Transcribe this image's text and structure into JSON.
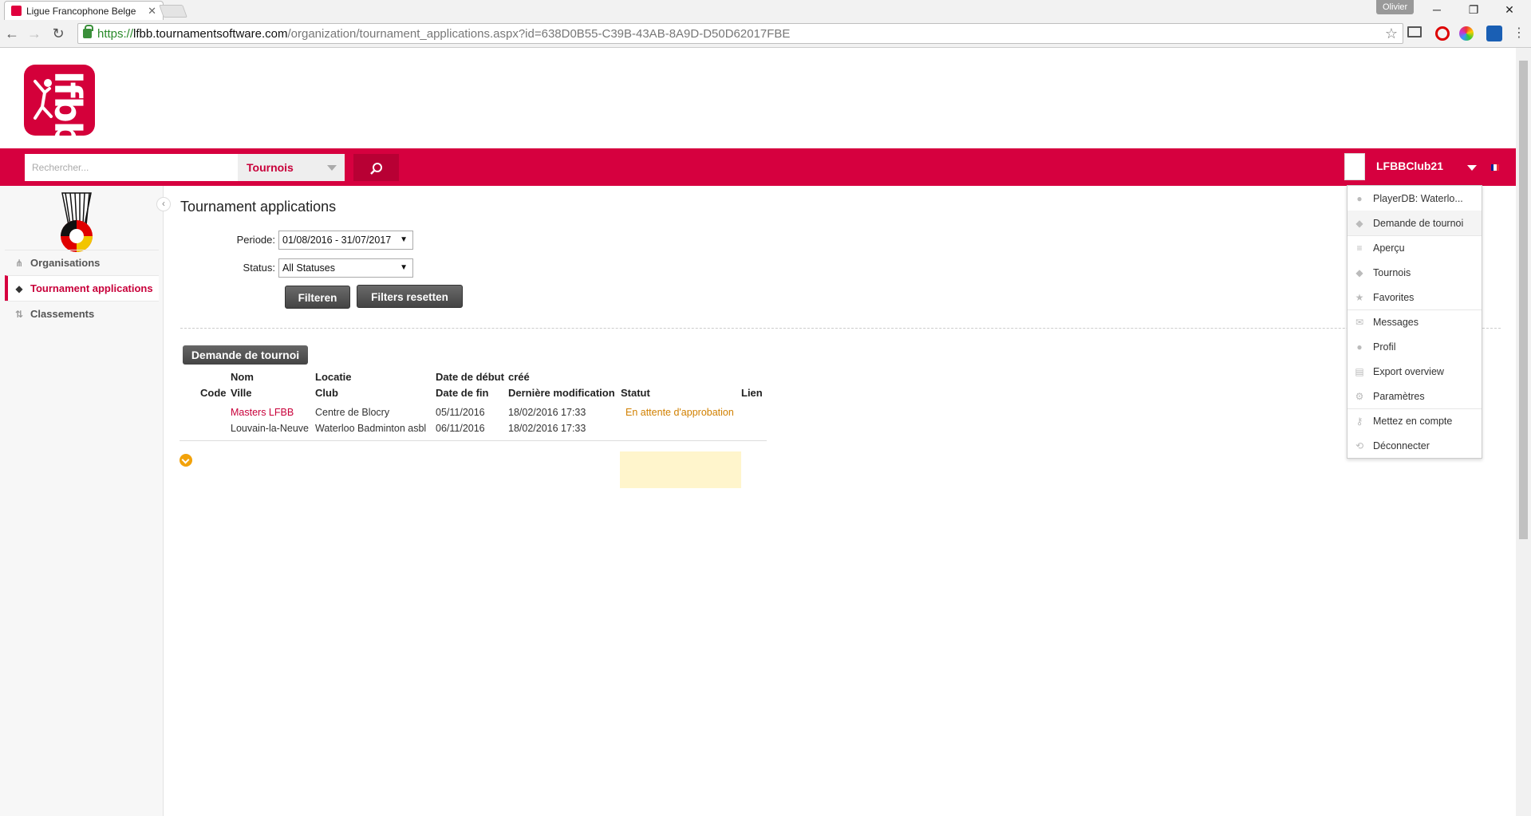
{
  "browser": {
    "tab_title": "Ligue Francophone Belge",
    "profile": "Olivier",
    "url_scheme": "https://",
    "url_host": "lfbb.tournamentsoftware.com",
    "url_path": "/organization/tournament_applications.aspx?id=638D0B55-C39B-43AB-8A9D-D50D62017FBE"
  },
  "site": {
    "logo_text": "lfbb",
    "search_placeholder": "Rechercher...",
    "search_type": "Tournois",
    "user_name": "LFBBClub21"
  },
  "user_menu": [
    {
      "label": "PlayerDB: Waterlo...",
      "icon": "user-icon"
    },
    {
      "label": "Demande de tournoi",
      "icon": "shuttle-icon"
    },
    {
      "label": "Aperçu",
      "icon": "list-icon"
    },
    {
      "label": "Tournois",
      "icon": "shuttle-icon"
    },
    {
      "label": "Favorites",
      "icon": "star-icon"
    },
    {
      "label": "Messages",
      "icon": "mail-icon"
    },
    {
      "label": "Profil",
      "icon": "user-icon"
    },
    {
      "label": "Export overview",
      "icon": "export-icon"
    },
    {
      "label": "Paramètres",
      "icon": "gear-icon"
    },
    {
      "label": "Mettez en compte",
      "icon": "key-icon"
    },
    {
      "label": "Déconnecter",
      "icon": "logout-icon"
    }
  ],
  "sidebar": {
    "items": [
      {
        "label": "Organisations"
      },
      {
        "label": "Tournament applications"
      },
      {
        "label": "Classements"
      }
    ]
  },
  "main": {
    "title": "Tournament applications",
    "periode_label": "Periode:",
    "periode_value": "01/08/2016 - 31/07/2017",
    "status_label": "Status:",
    "status_value": "All Statuses",
    "filter_btn": "Filteren",
    "reset_btn": "Filters resetten",
    "request_btn": "Demande de tournoi"
  },
  "table": {
    "headers": {
      "nom": "Nom",
      "code": "Code",
      "ville": "Ville",
      "locatie": "Locatie",
      "club": "Club",
      "date_debut": "Date de début",
      "date_fin": "Date de fin",
      "cree": "créé",
      "derniere_modification": "Dernière modification",
      "statut": "Statut",
      "lien": "Lien"
    },
    "rows": [
      {
        "nom": "Masters LFBB",
        "ville": "Louvain-la-Neuve",
        "locatie": "Centre de Blocry",
        "club": "Waterloo Badminton asbl",
        "date_debut": "05/11/2016",
        "date_fin": "06/11/2016",
        "cree": "18/02/2016 17:33",
        "derniere_modification": "18/02/2016 17:33",
        "statut": "En attente d'approbation"
      }
    ]
  },
  "colors": {
    "brand": "#d6003f",
    "status_bg": "#fff5cc",
    "status_text": "#d18000"
  }
}
